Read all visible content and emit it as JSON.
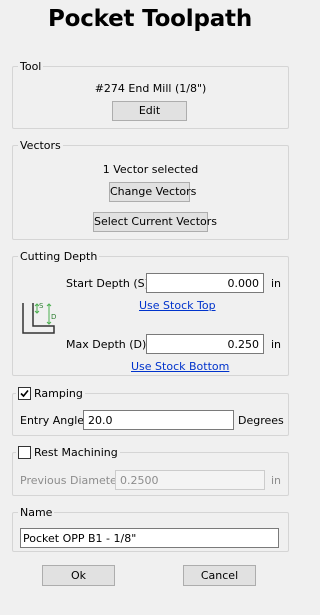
{
  "title": "Pocket Toolpath",
  "tool": {
    "legend": "Tool",
    "name": "#274 End Mill (1/8\")",
    "edit_label": "Edit"
  },
  "vectors": {
    "legend": "Vectors",
    "status": "1 Vector selected",
    "change_label": "Change Vectors",
    "select_current_label": "Select Current Vectors"
  },
  "cutting_depth": {
    "legend": "Cutting Depth",
    "start_label": "Start Depth (S)",
    "start_value": "0.000",
    "start_unit": "in",
    "use_stock_top": "Use Stock Top",
    "max_label": "Max Depth (D)",
    "max_value": "0.250",
    "max_unit": "in",
    "use_stock_bottom": "Use Stock Bottom",
    "diagram_s": "S",
    "diagram_d": "D"
  },
  "ramping": {
    "label": "Ramping",
    "checked": true,
    "entry_angle_label": "Entry Angle",
    "entry_angle_value": "20.0",
    "entry_angle_unit": "Degrees"
  },
  "rest_machining": {
    "label": "Rest Machining",
    "checked": false,
    "prev_diameter_label": "Previous Diameter",
    "prev_diameter_value": "0.2500",
    "prev_diameter_unit": "in"
  },
  "name_group": {
    "legend": "Name",
    "value": "Pocket OPP B1 - 1/8\""
  },
  "footer": {
    "ok_label": "Ok",
    "cancel_label": "Cancel"
  },
  "icons": {
    "checkbox_checked": "checkmark-icon",
    "depth_diagram": "depth-diagram-icon"
  },
  "colors": {
    "link": "#0033cc",
    "diagram_arrow": "#4caf50"
  }
}
